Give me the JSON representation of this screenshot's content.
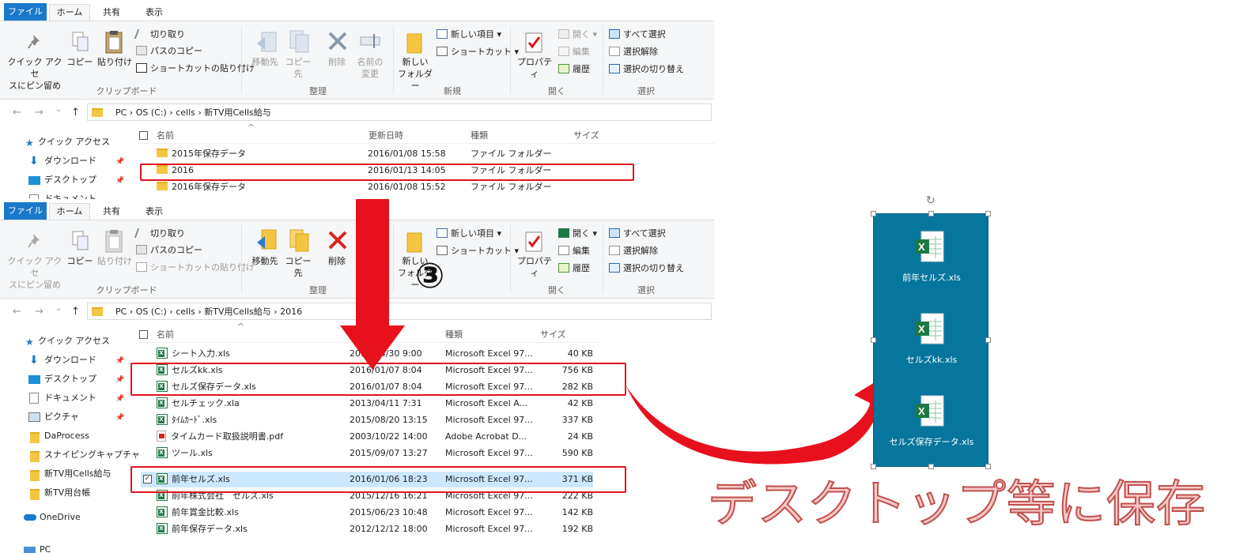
{
  "tabs": {
    "file": "ファイル",
    "home": "ホーム",
    "share": "共有",
    "view": "表示"
  },
  "ribbon1": {
    "pin_quick": "クイック アクセ\nスにピン留め",
    "copy": "コピー",
    "paste": "貼り付け",
    "cut": "切り取り",
    "copy_path": "パスのコピー",
    "paste_shortcut": "ショートカットの貼り付け",
    "clipboard": "クリップボード",
    "move_to": "移動先",
    "copy_to": "コピー先",
    "delete": "削除",
    "rename": "名前の\n変更",
    "organize": "整理",
    "new_folder": "新しい\nフォルダー",
    "new_item": "新しい項目 ▾",
    "shortcut": "ショートカット ▾",
    "new_group": "新規",
    "properties": "プロパティ",
    "open": "開く ▾",
    "edit": "編集",
    "history": "履歴",
    "open_group": "開く",
    "select_all": "すべて選択",
    "select_none": "選択解除",
    "invert": "選択の切り替え",
    "select_group": "選択"
  },
  "ribbon2": {
    "rename_hidden": "",
    "new_folder": "新しい\nフォルダー"
  },
  "address1": {
    "crumbs": "PC  ›  OS (C:)  ›  cells  ›  新TV用Cells給与"
  },
  "address2": {
    "crumbs": "PC  ›  OS (C:)  ›  cells  ›  新TV用Cells給与  ›  2016"
  },
  "nav_glyphs": {
    "back": "←",
    "forward": "→",
    "down": "⌄",
    "up": "↑"
  },
  "sidebar1": {
    "quick": "クイック アクセス",
    "download": "ダウンロード",
    "desktop": "デスクトップ",
    "documents": "ドキュメント"
  },
  "sidebar2": {
    "quick": "クイック アクセス",
    "download": "ダウンロード",
    "desktop": "デスクトップ",
    "documents": "ドキュメント",
    "pictures": "ピクチャ",
    "daprocess": "DaProcess",
    "snipping": "スナイピングキャプチャ",
    "cells": "新TV用Cells給与",
    "ledger": "新TV用台帳",
    "onedrive": "OneDrive",
    "pc": "PC"
  },
  "headers": {
    "name": "名前",
    "modified": "更新日時",
    "type": "種類",
    "size": "サイズ"
  },
  "list1": [
    {
      "name": "2015年保存データ",
      "date": "2016/01/08 15:58",
      "type": "ファイル フォルダー"
    },
    {
      "name": "2016",
      "date": "2016/01/13 14:05",
      "type": "ファイル フォルダー"
    },
    {
      "name": "2016年保存データ",
      "date": "2016/01/08 15:52",
      "type": "ファイル フォルダー"
    }
  ],
  "list2": [
    {
      "name": "シート入力.xls",
      "date": "2013/04/30 9:00",
      "type": "Microsoft Excel 97...",
      "size": "40 KB"
    },
    {
      "name": "セルズkk.xls",
      "date": "2016/01/07 8:04",
      "type": "Microsoft Excel 97...",
      "size": "756 KB"
    },
    {
      "name": "セルズ保存データ.xls",
      "date": "2016/01/07 8:04",
      "type": "Microsoft Excel 97...",
      "size": "282 KB"
    },
    {
      "name": "セルチェック.xla",
      "date": "2013/04/11 7:31",
      "type": "Microsoft Excel A...",
      "size": "42 KB"
    },
    {
      "name": "ﾀｲﾑｶｰﾄﾞ.xls",
      "date": "2015/08/20 13:15",
      "type": "Microsoft Excel 97...",
      "size": "337 KB"
    },
    {
      "name": "タイムカード取扱説明書.pdf",
      "date": "2003/10/22 14:00",
      "type": "Adobe Acrobat D...",
      "size": "24 KB"
    },
    {
      "name": "ツール.xls",
      "date": "2015/09/07 13:27",
      "type": "Microsoft Excel 97...",
      "size": "590 KB"
    },
    {
      "name": "前年セルズ.xls",
      "date": "2016/01/06 18:23",
      "type": "Microsoft Excel 97...",
      "size": "371 KB"
    },
    {
      "name": "前年株式会社　セルズ.xls",
      "date": "2015/12/16 16:21",
      "type": "Microsoft Excel 97...",
      "size": "222 KB"
    },
    {
      "name": "前年賞金比較.xls",
      "date": "2015/06/23 10:48",
      "type": "Microsoft Excel 97...",
      "size": "142 KB"
    },
    {
      "name": "前年保存データ.xls",
      "date": "2012/12/12 18:00",
      "type": "Microsoft Excel 97...",
      "size": "192 KB"
    }
  ],
  "step_label": "③",
  "desktop_icons": [
    "前年セルズ.xls",
    "セルズkk.xls",
    "セルズ保存データ.xls"
  ],
  "caption": "デスクトップ等に保存",
  "colors": {
    "accent": "#1979ca",
    "highlight": "#e0141e",
    "desktop": "#07769c"
  }
}
